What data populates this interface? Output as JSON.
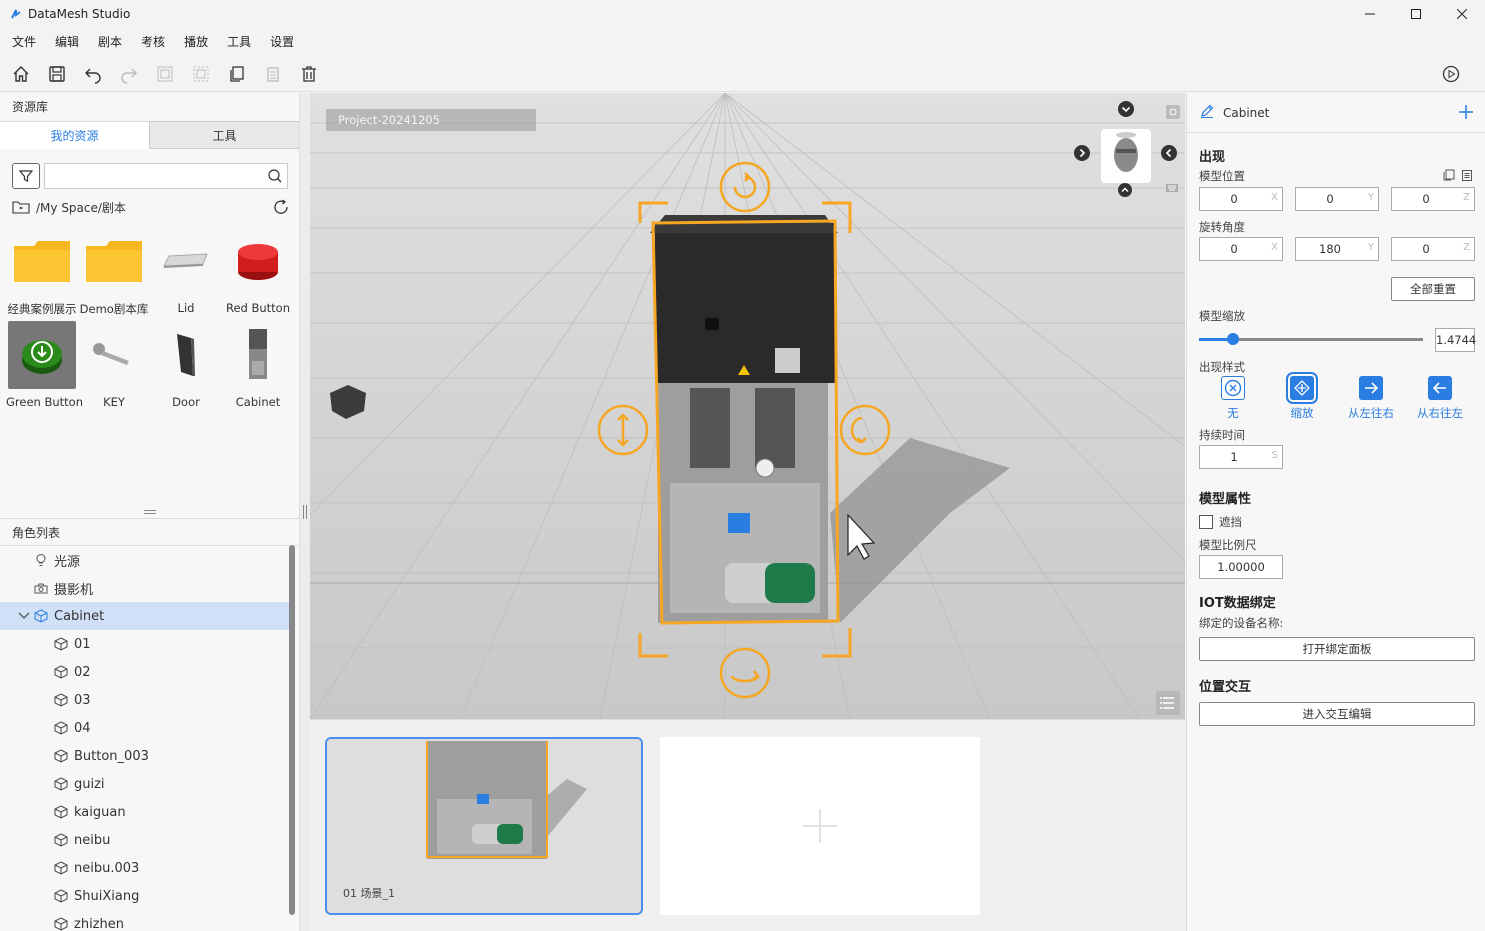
{
  "window": {
    "title": "DataMesh Studio"
  },
  "menu": [
    "文件",
    "编辑",
    "剧本",
    "考核",
    "播放",
    "工具",
    "设置"
  ],
  "left": {
    "resource_heading": "资源库",
    "tabs": {
      "mine": "我的资源",
      "tools": "工具"
    },
    "search_placeholder": "",
    "path": "/My Space/剧本",
    "assets": [
      {
        "label": "经典案例展示",
        "icon": "folder-icon"
      },
      {
        "label": "Demo剧本库",
        "icon": "folder-icon"
      },
      {
        "label": "Lid",
        "icon": "lid-model-icon"
      },
      {
        "label": "Red Button",
        "icon": "red-button-model-icon"
      },
      {
        "label": "Green Button",
        "icon": "green-button-model-icon"
      },
      {
        "label": "KEY",
        "icon": "key-model-icon"
      },
      {
        "label": "Door",
        "icon": "door-model-icon"
      },
      {
        "label": "Cabinet",
        "icon": "cabinet-model-icon"
      }
    ],
    "role_heading": "角色列表",
    "roles": [
      {
        "label": "光源",
        "icon": "light-bulb-icon",
        "level": 1
      },
      {
        "label": "摄影机",
        "icon": "camera-icon",
        "level": 1
      },
      {
        "label": "Cabinet",
        "icon": "cube-icon",
        "level": 1,
        "expanded": true
      },
      {
        "label": "01",
        "icon": "cube-icon",
        "level": 2
      },
      {
        "label": "02",
        "icon": "cube-icon",
        "level": 2
      },
      {
        "label": "03",
        "icon": "cube-icon",
        "level": 2
      },
      {
        "label": "04",
        "icon": "cube-icon",
        "level": 2
      },
      {
        "label": "Button_003",
        "icon": "cube-icon",
        "level": 2
      },
      {
        "label": "guizi",
        "icon": "cube-icon",
        "level": 2
      },
      {
        "label": "kaiguan",
        "icon": "cube-icon",
        "level": 2
      },
      {
        "label": "neibu",
        "icon": "cube-icon",
        "level": 2
      },
      {
        "label": "neibu.003",
        "icon": "cube-icon",
        "level": 2
      },
      {
        "label": "ShuiXiang",
        "icon": "cube-icon",
        "level": 2
      },
      {
        "label": "zhizhen",
        "icon": "cube-icon",
        "level": 2
      }
    ]
  },
  "viewport": {
    "project": "Project-20241205"
  },
  "scene_strip": {
    "scene_label": "01   场景_1"
  },
  "right": {
    "object_name": "Cabinet",
    "appear_title": "出现",
    "position_label": "模型位置",
    "position": {
      "x": "0",
      "y": "0",
      "z": "0"
    },
    "rotation_label": "旋转角度",
    "rotation": {
      "x": "0",
      "y": "180",
      "z": "0"
    },
    "axis": {
      "x": "X",
      "y": "Y",
      "z": "Z"
    },
    "reset_all": "全部重置",
    "scale_label": "模型缩放",
    "scale_value": "1.4744",
    "scale_fraction": 0.15,
    "style_label": "出现样式",
    "styles": [
      {
        "label": "无",
        "icon": "none-icon"
      },
      {
        "label": "缩放",
        "icon": "scale-icon"
      },
      {
        "label": "从左往右",
        "icon": "arrow-right-icon"
      },
      {
        "label": "从右往左",
        "icon": "arrow-left-icon"
      }
    ],
    "duration_label": "持续时间",
    "duration_value": "1",
    "duration_unit": "S",
    "props_title": "模型属性",
    "occlude_label": "遮挡",
    "ratio_label": "模型比例尺",
    "ratio_value": "1.00000",
    "iot_title": "IOT数据绑定",
    "iot_device_label": "绑定的设备名称:",
    "iot_button": "打开绑定面板",
    "pos_interact_title": "位置交互",
    "pos_interact_button": "进入交互编辑"
  },
  "colors": {
    "accent": "#2a7de1",
    "selection": "#f5a623"
  }
}
